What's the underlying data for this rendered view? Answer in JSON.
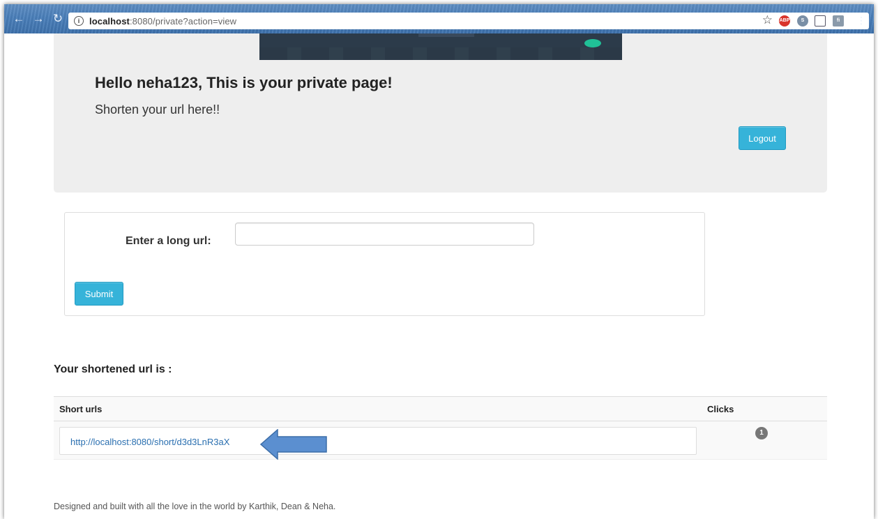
{
  "browser": {
    "url_host": "localhost",
    "url_rest": ":8080/private?action=view"
  },
  "header": {
    "greeting": "Hello neha123, This is your private page!",
    "lead": "Shorten your url here!!",
    "logout_label": "Logout"
  },
  "form": {
    "label": "Enter a long url:",
    "input_value": "",
    "submit_label": "Submit"
  },
  "results": {
    "title": "Your shortened url is :",
    "columns": [
      "Short urls",
      "Clicks"
    ],
    "rows": [
      {
        "short_url": "http://localhost:8080/short/d3d3LnR3aX",
        "clicks": "1"
      }
    ]
  },
  "footer": {
    "text": "Designed and built with all the love in the world by Karthik, Dean & Neha."
  },
  "colors": {
    "accent": "#36b3d9",
    "link": "#2a6fb0",
    "arrow": "#5b8fd0"
  }
}
